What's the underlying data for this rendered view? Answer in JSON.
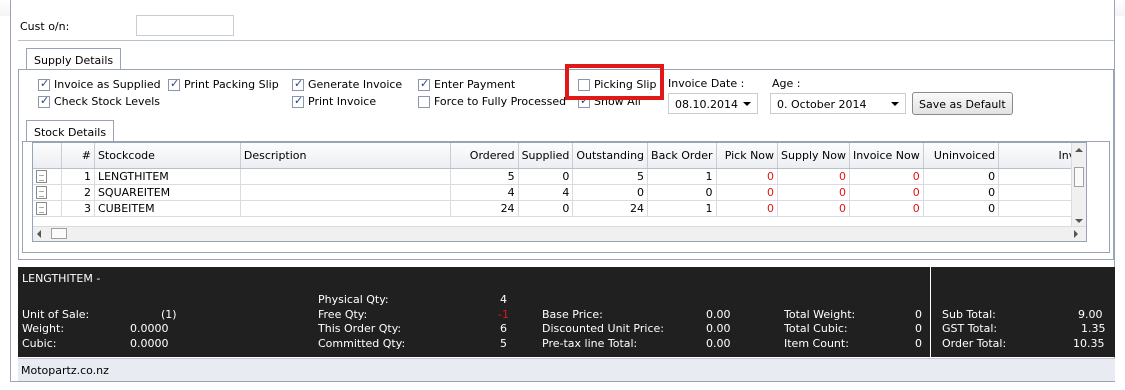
{
  "cust": {
    "label": "Cust o/n:",
    "value": ""
  },
  "supply_tab": {
    "label": "Supply Details"
  },
  "options": {
    "invoice_as_supplied": {
      "label": "Invoice as Supplied",
      "checked": true
    },
    "check_stock_levels": {
      "label": "Check Stock Levels",
      "checked": true
    },
    "print_packing_slip": {
      "label": "Print Packing Slip",
      "checked": true
    },
    "generate_invoice": {
      "label": "Generate Invoice",
      "checked": true
    },
    "print_invoice": {
      "label": "Print Invoice",
      "checked": true
    },
    "enter_payment": {
      "label": "Enter Payment",
      "checked": true
    },
    "force_fully_processed": {
      "label": "Force to Fully Processed",
      "checked": false
    },
    "picking_slip": {
      "label": "Picking Slip",
      "checked": false
    },
    "show_all": {
      "label": "Show All",
      "checked": true
    }
  },
  "invoice_date": {
    "label": "Invoice Date :",
    "value": "08.10.2014"
  },
  "age": {
    "label": "Age :",
    "value": "0. October 2014"
  },
  "save_default": {
    "label": "Save as Default"
  },
  "stock_tab": {
    "label": "Stock Details"
  },
  "grid": {
    "columns": [
      "#",
      "Stockcode",
      "Description",
      "Ordered",
      "Supplied",
      "Outstanding",
      "Back Order",
      "Pick Now",
      "Supply Now",
      "Invoice Now",
      "Uninvoiced",
      "Invo"
    ],
    "rows": [
      {
        "n": "1",
        "code": "LENGTHITEM",
        "desc": "",
        "ordered": "5",
        "supplied": "0",
        "outstanding": "5",
        "back": "1",
        "pick": "0",
        "supply": "0",
        "invoice": "0",
        "uninv": "0"
      },
      {
        "n": "2",
        "code": "SQUAREITEM",
        "desc": "",
        "ordered": "4",
        "supplied": "4",
        "outstanding": "0",
        "back": "0",
        "pick": "0",
        "supply": "0",
        "invoice": "0",
        "uninv": "0"
      },
      {
        "n": "3",
        "code": "CUBEITEM",
        "desc": "",
        "ordered": "24",
        "supplied": "0",
        "outstanding": "24",
        "back": "1",
        "pick": "0",
        "supply": "0",
        "invoice": "0",
        "uninv": "0"
      }
    ]
  },
  "summary": {
    "item": "LENGTHITEM -",
    "unit_of_sale": {
      "label": "Unit of Sale:",
      "value": "(1)"
    },
    "weight": {
      "label": "Weight:",
      "value": "0.0000"
    },
    "cubic": {
      "label": "Cubic:",
      "value": "0.0000"
    },
    "physical_qty": {
      "label": "Physical Qty:",
      "value": "4"
    },
    "free_qty": {
      "label": "Free Qty:",
      "value": "-1"
    },
    "this_order_qty": {
      "label": "This Order Qty:",
      "value": "6"
    },
    "committed_qty": {
      "label": "Committed Qty:",
      "value": "5"
    },
    "base_price": {
      "label": "Base Price:",
      "value": "0.00"
    },
    "disc_unit_price": {
      "label": "Discounted Unit Price:",
      "value": "0.00"
    },
    "pretax_total": {
      "label": "Pre-tax line Total:",
      "value": "0.00"
    },
    "total_weight": {
      "label": "Total Weight:",
      "value": "0"
    },
    "total_cubic": {
      "label": "Total Cubic:",
      "value": "0"
    },
    "item_count": {
      "label": "Item Count:",
      "value": "0"
    },
    "sub_total": {
      "label": "Sub Total:",
      "value": "9.00"
    },
    "gst_total": {
      "label": "GST Total:",
      "value": "1.35"
    },
    "order_total": {
      "label": "Order Total:",
      "value": "10.35"
    }
  },
  "status": {
    "text": "Motopartz.co.nz"
  },
  "colors": {
    "highlight": "#e01818",
    "negative": "#e01818",
    "summary_bg": "#202020"
  }
}
